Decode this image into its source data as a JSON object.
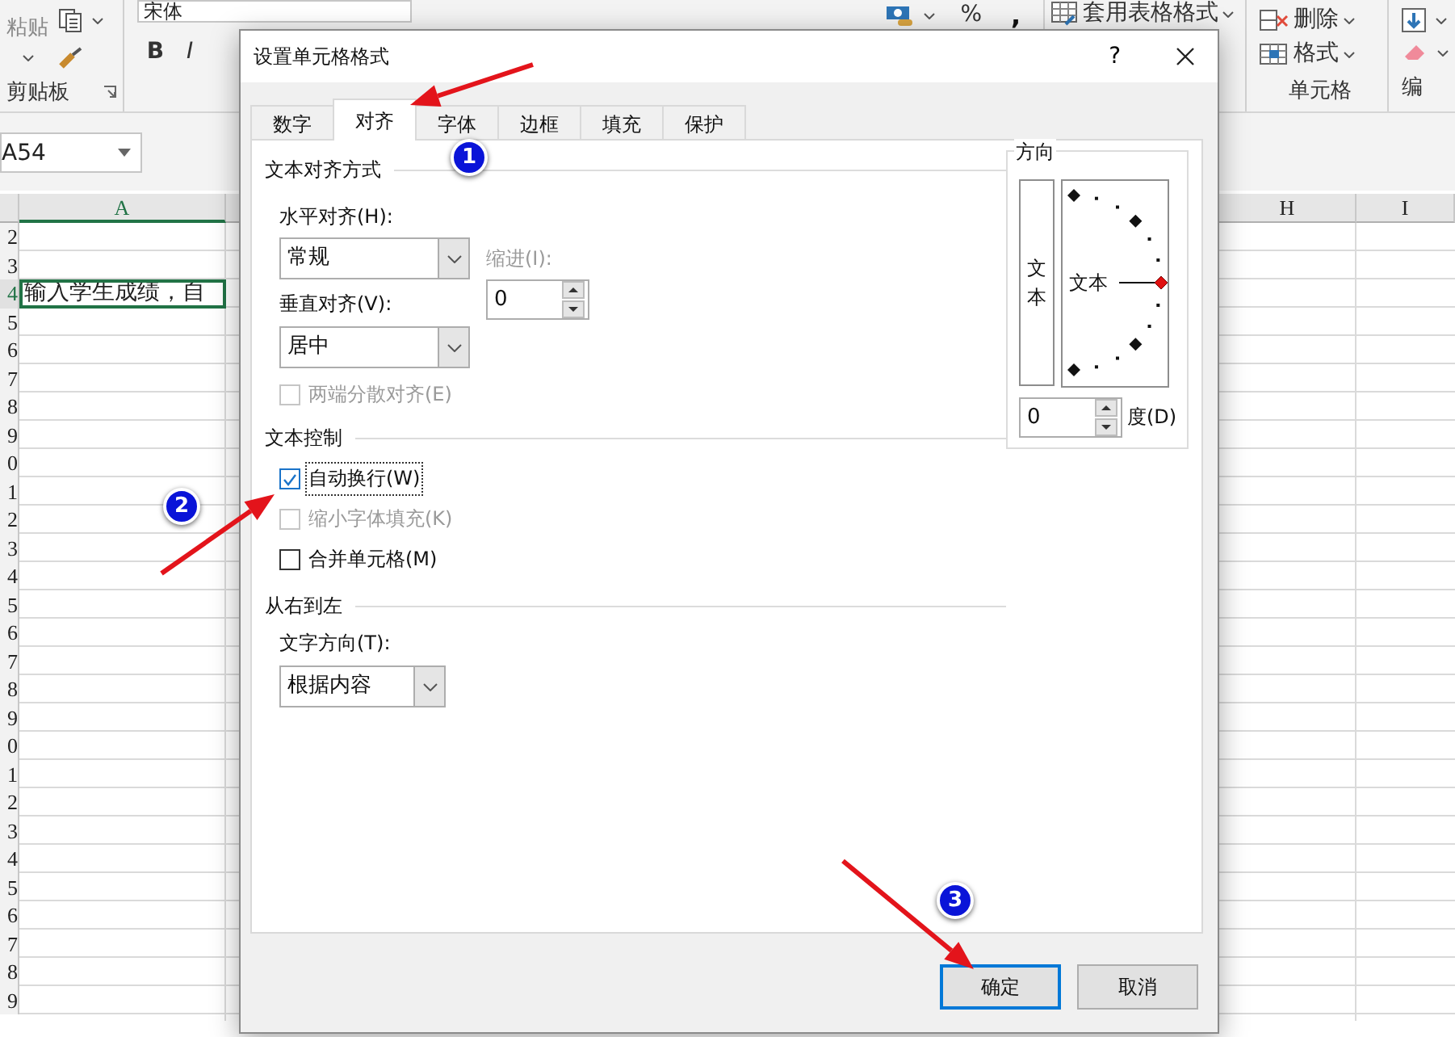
{
  "ribbon": {
    "clipboard": {
      "paste": "粘贴",
      "group_label": "剪贴板"
    },
    "font": {
      "font_name": "宋体",
      "bold": "B",
      "italic": "I"
    },
    "number": {
      "percent": "%",
      "comma": ","
    },
    "styles": {
      "table_format": "套用表格格式"
    },
    "cells": {
      "delete": "删除",
      "format": "格式",
      "group_label": "单元格"
    },
    "editing": {
      "group_label": "编"
    }
  },
  "name_box": "A54",
  "sheet": {
    "columns": [
      {
        "label": "A",
        "selected": true
      },
      {
        "label": "H",
        "selected": false
      },
      {
        "label": "I",
        "selected": false
      }
    ],
    "rows": [
      {
        "number": "2",
        "selected": false
      },
      {
        "number": "3",
        "selected": false
      },
      {
        "number": "4",
        "selected": true,
        "cell_a": "输入学生成绩，自"
      },
      {
        "number": "5",
        "selected": false
      },
      {
        "number": "6",
        "selected": false
      },
      {
        "number": "7",
        "selected": false
      },
      {
        "number": "8",
        "selected": false
      },
      {
        "number": "9",
        "selected": false
      },
      {
        "number": "0",
        "selected": false
      },
      {
        "number": "1",
        "selected": false
      },
      {
        "number": "2",
        "selected": false
      },
      {
        "number": "3",
        "selected": false
      },
      {
        "number": "4",
        "selected": false
      },
      {
        "number": "5",
        "selected": false
      },
      {
        "number": "6",
        "selected": false
      },
      {
        "number": "7",
        "selected": false
      },
      {
        "number": "8",
        "selected": false
      },
      {
        "number": "9",
        "selected": false
      },
      {
        "number": "0",
        "selected": false
      },
      {
        "number": "1",
        "selected": false
      },
      {
        "number": "2",
        "selected": false
      },
      {
        "number": "3",
        "selected": false
      },
      {
        "number": "4",
        "selected": false
      },
      {
        "number": "5",
        "selected": false
      },
      {
        "number": "6",
        "selected": false
      },
      {
        "number": "7",
        "selected": false
      },
      {
        "number": "8",
        "selected": false
      },
      {
        "number": "9",
        "selected": false
      }
    ]
  },
  "dialog": {
    "title": "设置单元格格式",
    "help": "?",
    "tabs": [
      {
        "label": "数字",
        "selected": false
      },
      {
        "label": "对齐",
        "selected": true
      },
      {
        "label": "字体",
        "selected": false
      },
      {
        "label": "边框",
        "selected": false
      },
      {
        "label": "填充",
        "selected": false
      },
      {
        "label": "保护",
        "selected": false
      }
    ],
    "alignment": {
      "heading": "文本对齐方式",
      "horizontal": {
        "label": "水平对齐(H):",
        "value": "常规"
      },
      "indent": {
        "label": "缩进(I):",
        "value": "0",
        "disabled": true
      },
      "vertical": {
        "label": "垂直对齐(V):",
        "value": "居中"
      },
      "distributed": {
        "label": "两端分散对齐(E)",
        "checked": false,
        "disabled": true
      }
    },
    "text_control": {
      "heading": "文本控制",
      "options": [
        {
          "label": "自动换行(W)",
          "checked": true,
          "disabled": false,
          "focused": true
        },
        {
          "label": "缩小字体填充(K)",
          "checked": false,
          "disabled": true,
          "focused": false
        },
        {
          "label": "合并单元格(M)",
          "checked": false,
          "disabled": false,
          "focused": false
        }
      ]
    },
    "rtl": {
      "heading": "从右到左",
      "direction": {
        "label": "文字方向(T):",
        "value": "根据内容"
      }
    },
    "orientation": {
      "heading": "方向",
      "vertical_text": "文本",
      "dial_text": "文本",
      "degrees": {
        "value": "0",
        "label": "度(D)"
      }
    },
    "buttons": [
      {
        "label": "确定",
        "default": true
      },
      {
        "label": "取消",
        "default": false
      }
    ]
  },
  "annotations": [
    {
      "number": "1"
    },
    {
      "number": "2"
    },
    {
      "number": "3"
    }
  ]
}
